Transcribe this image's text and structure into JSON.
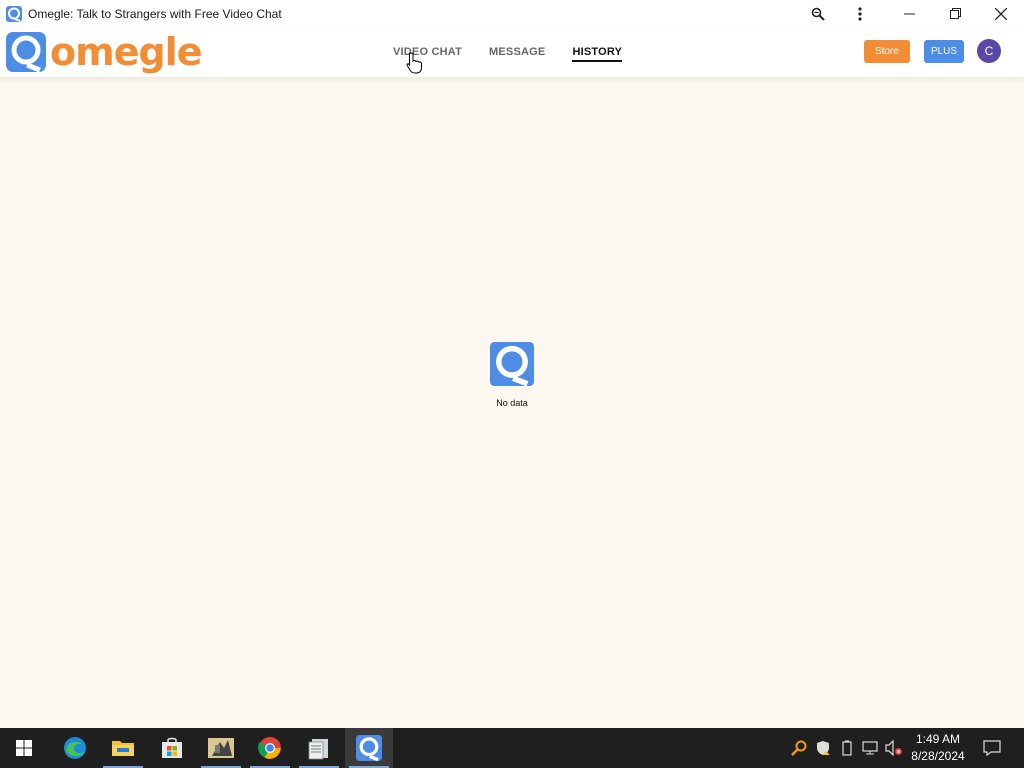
{
  "window": {
    "title": "Omegle: Talk to Strangers with Free Video Chat",
    "controls": [
      "minimize-icon",
      "restore-icon",
      "close-icon"
    ]
  },
  "header": {
    "logo_text": "omegle",
    "nav": [
      {
        "label": "VIDEO CHAT",
        "active": false
      },
      {
        "label": "MESSAGE",
        "active": false
      },
      {
        "label": "HISTORY",
        "active": true
      }
    ],
    "store_label": "Store",
    "plus_label": "PLUS",
    "avatar_initial": "C"
  },
  "main": {
    "empty_text": "No data"
  },
  "taskbar": {
    "apps": [
      "start-icon",
      "edge-icon",
      "file-explorer-icon",
      "store-icon",
      "app-icon",
      "chrome-icon",
      "notepad-icon",
      "omegle-icon"
    ],
    "time": "1:49 AM",
    "date": "8/28/2024"
  },
  "colors": {
    "brand_orange": "#f28d35",
    "brand_blue": "#4d8de6",
    "page_bg": "#fcf8f0",
    "taskbar_bg": "#1f1f1f",
    "avatar_bg": "#5a48a8"
  }
}
